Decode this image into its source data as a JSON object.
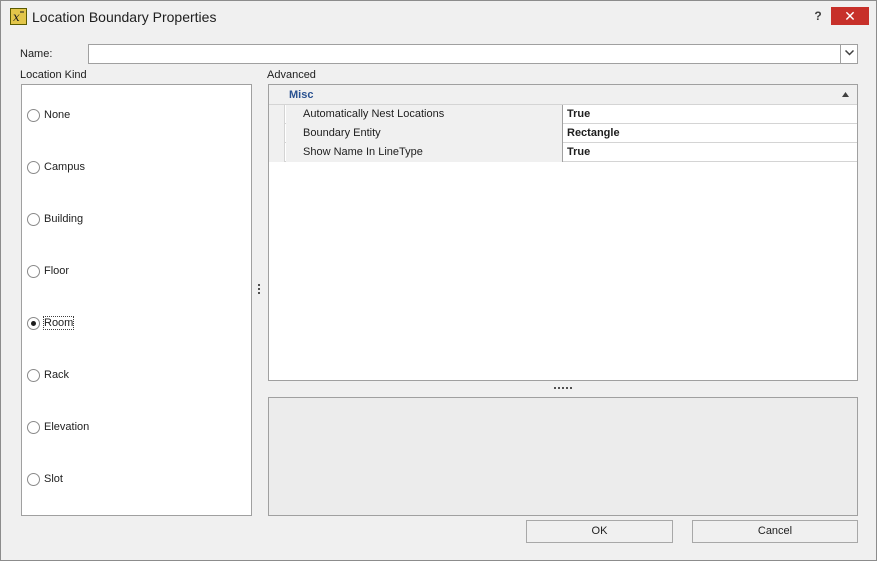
{
  "window": {
    "title": "Location Boundary Properties",
    "help_label": "?",
    "close_label": "✕"
  },
  "name_field": {
    "label": "Name:",
    "value": ""
  },
  "location_kind": {
    "label": "Location Kind",
    "options": [
      {
        "label": "None",
        "checked": false
      },
      {
        "label": "Campus",
        "checked": false
      },
      {
        "label": "Building",
        "checked": false
      },
      {
        "label": "Floor",
        "checked": false
      },
      {
        "label": "Room",
        "checked": true
      },
      {
        "label": "Rack",
        "checked": false
      },
      {
        "label": "Elevation",
        "checked": false
      },
      {
        "label": "Slot",
        "checked": false
      }
    ]
  },
  "advanced": {
    "label": "Advanced",
    "category": "Misc",
    "properties": [
      {
        "name": "Automatically Nest Locations",
        "value": "True"
      },
      {
        "name": "Boundary Entity",
        "value": "Rectangle"
      },
      {
        "name": "Show Name In LineType",
        "value": "True"
      }
    ]
  },
  "buttons": {
    "ok": "OK",
    "cancel": "Cancel"
  },
  "colors": {
    "accent": "#2a5291",
    "close": "#c7302a",
    "app_icon": "#e3c64a"
  }
}
